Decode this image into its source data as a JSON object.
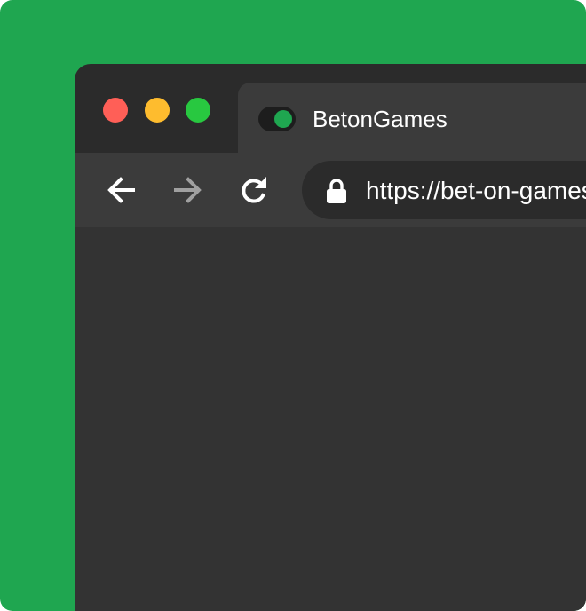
{
  "colors": {
    "backdrop": "#1fa650",
    "window_frame": "#2b2b2b",
    "tab_active": "#3b3b3b",
    "toolbar": "#3b3b3b",
    "address_bar": "#2b2b2b",
    "content": "#333333",
    "traffic_close": "#ff5f57",
    "traffic_minimize": "#febc2e",
    "traffic_maximize": "#28c840",
    "toggle_track": "#1d1d1d",
    "toggle_knob": "#1fa650",
    "text": "#ffffff",
    "icon_active": "#ffffff",
    "icon_disabled": "#a0a0a0"
  },
  "tab": {
    "title": "BetonGames",
    "favicon": "toggle-icon"
  },
  "toolbar": {
    "back_icon": "arrow-left-icon",
    "forward_icon": "arrow-right-icon",
    "reload_icon": "reload-icon"
  },
  "address_bar": {
    "lock_icon": "lock-icon",
    "url": "https://bet-on-games"
  }
}
